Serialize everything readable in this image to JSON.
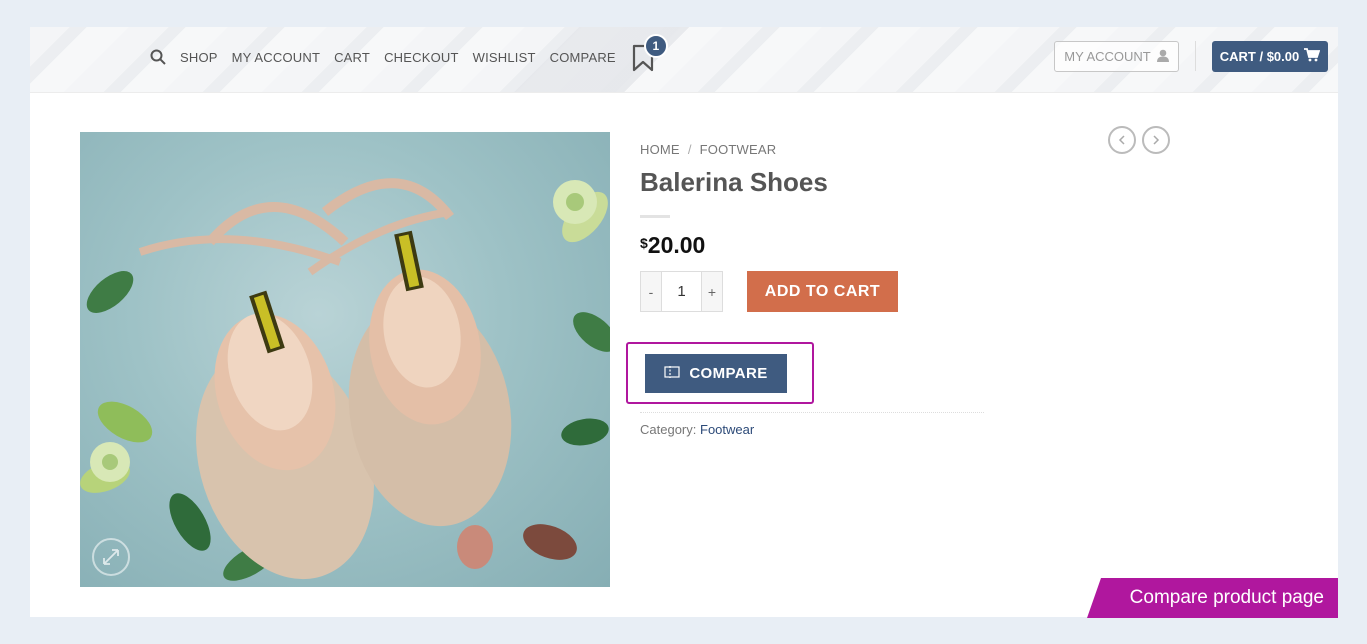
{
  "header": {
    "nav": [
      {
        "label": "SHOP"
      },
      {
        "label": "MY ACCOUNT"
      },
      {
        "label": "CART"
      },
      {
        "label": "CHECKOUT"
      },
      {
        "label": "WISHLIST"
      },
      {
        "label": "COMPARE"
      }
    ],
    "wishlist_count": "1",
    "account_button": "MY ACCOUNT",
    "cart_button": "CART / $0.00"
  },
  "product": {
    "breadcrumb": {
      "home": "HOME",
      "separator": "/",
      "category": "FOOTWEAR"
    },
    "title": "Balerina Shoes",
    "price": {
      "currency": "$",
      "amount": "20.00"
    },
    "quantity": {
      "minus": "-",
      "value": "1",
      "plus": "+"
    },
    "add_to_cart": "ADD TO CART",
    "compare": "COMPARE",
    "category_label": "Category:",
    "category_value": "Footwear"
  },
  "ribbon": "Compare product page",
  "colors": {
    "primary": "#3f5b80",
    "add_to_cart": "#d26e4b",
    "highlight": "#b0179e"
  }
}
